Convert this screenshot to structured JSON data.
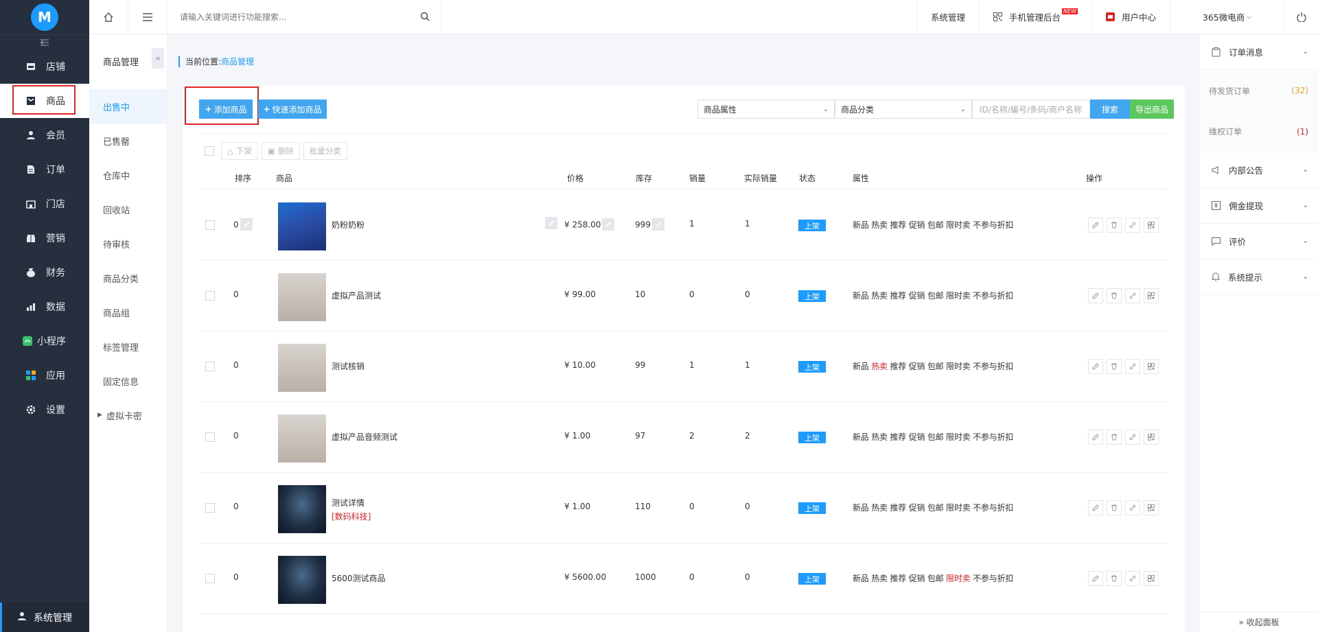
{
  "app": {
    "logo_letter": "M"
  },
  "sidebar": {
    "collapse_icon": "collapse-icon",
    "items": [
      {
        "label": "店铺",
        "icon": "shop-icon"
      },
      {
        "label": "商品",
        "icon": "goods-icon",
        "active": true
      },
      {
        "label": "会员",
        "icon": "member-icon"
      },
      {
        "label": "订单",
        "icon": "order-icon"
      },
      {
        "label": "门店",
        "icon": "store-icon"
      },
      {
        "label": "营销",
        "icon": "marketing-icon"
      },
      {
        "label": "财务",
        "icon": "finance-icon"
      },
      {
        "label": "数据",
        "icon": "data-icon"
      },
      {
        "label": "小程序",
        "icon": "miniprogram-icon"
      },
      {
        "label": "应用",
        "icon": "app-icon"
      },
      {
        "label": "设置",
        "icon": "settings-icon"
      }
    ],
    "bottom_label": "系统管理"
  },
  "subnav": {
    "title": "商品管理",
    "fold_glyph": "«",
    "items": [
      "出售中",
      "已售罄",
      "仓库中",
      "回收站",
      "待审核",
      "商品分类",
      "商品组",
      "标签管理",
      "固定信息"
    ],
    "tree_item": "虚拟卡密"
  },
  "topbar": {
    "search_placeholder": "请输入关键词进行功能搜索...",
    "system_mgmt": "系统管理",
    "mobile_admin": "手机管理后台",
    "new_badge": "NEW",
    "user_center": "用户中心",
    "shop_name": "365微电商"
  },
  "breadcrumb": {
    "prefix": "当前位置:",
    "current": "商品管理"
  },
  "toolbar": {
    "add_label": "添加商品",
    "quick_add_label": "快速添加商品",
    "attr_select": "商品属性",
    "category_select": "商品分类",
    "keyword_placeholder": "ID/名称/编号/条码/商户名称",
    "search_label": "搜索",
    "export_label": "导出商品"
  },
  "bulk": {
    "off_shelf": "下架",
    "delete": "删除",
    "batch_category": "批量分类"
  },
  "table": {
    "headers": {
      "sort": "排序",
      "product": "商品",
      "price": "价格",
      "stock": "库存",
      "sales": "销量",
      "real_sales": "实际销量",
      "status": "状态",
      "attrs": "属性",
      "ops": "操作"
    },
    "rows": [
      {
        "sort": "0",
        "name": "奶粉奶粉",
        "tag": "",
        "price": "¥ 258.00",
        "stock": "999",
        "sales": "1",
        "real": "1",
        "status": "上架",
        "image": "milk-powder",
        "hot_red": false,
        "limit_red": false,
        "editable": true
      },
      {
        "sort": "0",
        "name": "虚拟产品测试",
        "tag": "",
        "price": "¥ 99.00",
        "stock": "10",
        "sales": "0",
        "real": "0",
        "status": "上架",
        "image": "home-decor",
        "hot_red": false,
        "limit_red": false,
        "editable": false
      },
      {
        "sort": "0",
        "name": "测试核销",
        "tag": "",
        "price": "¥ 10.00",
        "stock": "99",
        "sales": "1",
        "real": "1",
        "status": "上架",
        "image": "home-decor",
        "hot_red": true,
        "limit_red": false,
        "editable": false
      },
      {
        "sort": "0",
        "name": "虚拟产品音频测试",
        "tag": "",
        "price": "¥ 1.00",
        "stock": "97",
        "sales": "2",
        "real": "2",
        "status": "上架",
        "image": "home-decor",
        "hot_red": false,
        "limit_red": false,
        "editable": false
      },
      {
        "sort": "0",
        "name": "测试详情",
        "tag": "[数码科技]",
        "price": "¥ 1.00",
        "stock": "110",
        "sales": "0",
        "real": "0",
        "status": "上架",
        "image": "night-house",
        "hot_red": false,
        "limit_red": false,
        "editable": false
      },
      {
        "sort": "0",
        "name": "5600测试商品",
        "tag": "",
        "price": "¥ 5600.00",
        "stock": "1000",
        "sales": "0",
        "real": "0",
        "status": "上架",
        "image": "night-house",
        "hot_red": false,
        "limit_red": true,
        "editable": false
      }
    ],
    "attr_labels": [
      "新品",
      "热卖",
      "推荐",
      "促销",
      "包邮",
      "限时卖",
      "不参与折扣"
    ]
  },
  "rpanel": {
    "order_msg": "订单消息",
    "pending_ship": "待发货订单",
    "pending_ship_count": "(32)",
    "rights_order": "维权订单",
    "rights_count": "(1)",
    "notice": "内部公告",
    "commission": "佣金提现",
    "review": "评价",
    "sys_tip": "系统提示",
    "collapse_panel": "» 收起面板"
  },
  "colors": {
    "accent": "#1e9bff",
    "sidebar_bg": "#262f3e",
    "export_green": "#5cc75d",
    "highlight_red": "#e02222"
  }
}
